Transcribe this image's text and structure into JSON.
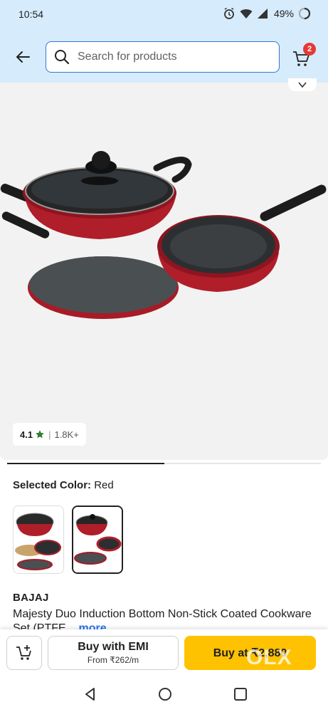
{
  "status_bar": {
    "time": "10:54",
    "battery": "49%"
  },
  "header": {
    "search_placeholder": "Search for products",
    "cart_count": "2"
  },
  "product": {
    "rating": "4.1",
    "rating_count": "1.8K+",
    "selected_color_label": "Selected Color:",
    "selected_color_value": "Red",
    "brand": "BAJAJ",
    "name": "Majesty Duo Induction Bottom Non-Stick Coated Cookware Set (PTFE...",
    "more_link": "more",
    "gallery_progress": 0.5
  },
  "actions": {
    "emi_title": "Buy with EMI",
    "emi_subtitle": "From ₹262/m",
    "buy_label": "Buy at ₹2,880",
    "watermark": "OLX"
  },
  "colors": {
    "accent": "#2f7bd6",
    "buy_button": "#ffc200",
    "header_bg": "#d6ebfb",
    "badge": "#e53935",
    "star": "#2e7d32"
  },
  "icons": [
    "alarm-icon",
    "wifi-icon",
    "signal-icon",
    "battery-icon",
    "back-arrow-icon",
    "search-icon",
    "cart-icon",
    "chevron-down-icon",
    "star-icon",
    "add-to-cart-icon",
    "nav-back-icon",
    "nav-home-icon",
    "nav-recents-icon"
  ]
}
